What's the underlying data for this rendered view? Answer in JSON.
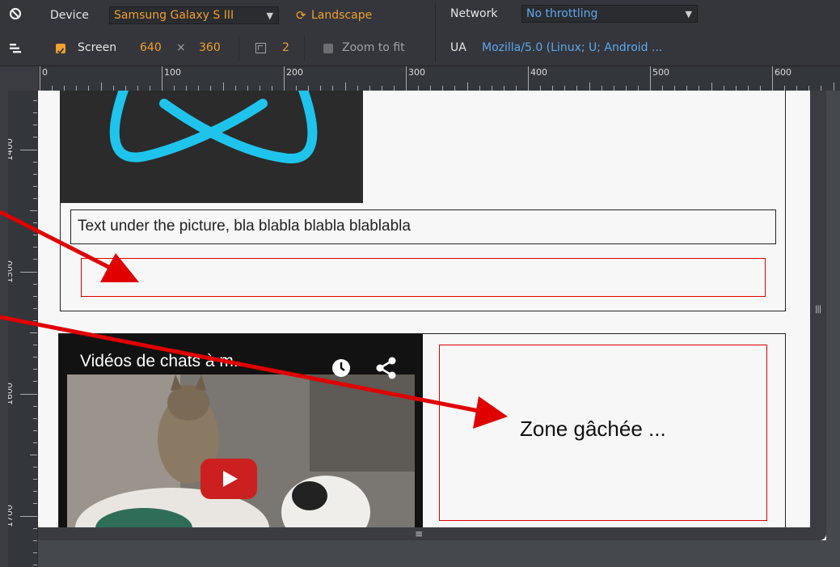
{
  "toolbar": {
    "device_label": "Device",
    "device_value": "Samsung Galaxy S III",
    "orientation_label": "Landscape",
    "network_label": "Network",
    "network_value": "No throttling",
    "screen_label": "Screen",
    "screen_width": "640",
    "screen_times": "×",
    "screen_height": "360",
    "dpr_value": "2",
    "zoom_label": "Zoom to fit",
    "ua_label": "UA",
    "ua_value": "Mozilla/5.0 (Linux; U; Android ...",
    "icons": {
      "no_emulation": "no-emulation-icon",
      "device_mode": "device-mode-icon",
      "rotate": "rotate-icon",
      "dpr": "device-pixel-ratio-icon"
    },
    "colors": {
      "orange": "#f0a030",
      "blue": "#5fa8ec"
    }
  },
  "ruler": {
    "horizontal_labels": [
      "0",
      "100",
      "200",
      "300",
      "400",
      "500",
      "600"
    ],
    "vertical_labels": [
      "1400",
      "1500",
      "1600",
      "1700"
    ]
  },
  "page": {
    "caption": "Text under the picture, bla blabla blabla blablabla",
    "video_title": "Vidéos de chats à m...",
    "zone_text": "Zone gâchée ...",
    "colors": {
      "logo": "#1fc4ec",
      "highlight_border": "#e00000",
      "annotation_arrow": "#e00000",
      "youtube_red": "#cc1f1f"
    }
  }
}
